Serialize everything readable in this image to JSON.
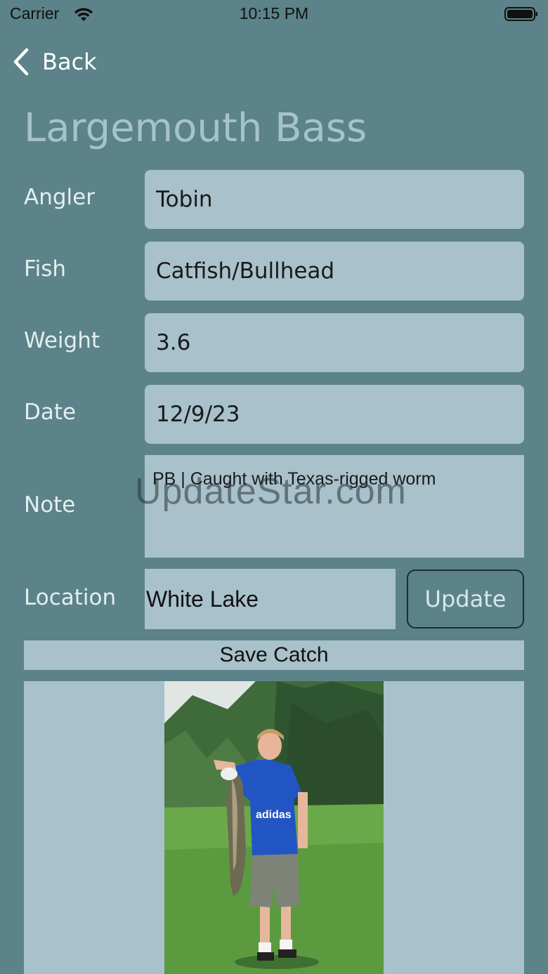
{
  "status_bar": {
    "carrier": "Carrier",
    "time": "10:15 PM",
    "wifi_icon": "wifi-icon",
    "battery_icon": "battery-full-icon"
  },
  "nav": {
    "back_label": "Back",
    "back_icon": "chevron-left-icon"
  },
  "title": "Largemouth Bass",
  "form": {
    "angler": {
      "label": "Angler",
      "value": "Tobin"
    },
    "fish": {
      "label": "Fish",
      "value": "Catfish/Bullhead"
    },
    "weight": {
      "label": "Weight",
      "value": "3.6"
    },
    "date": {
      "label": "Date",
      "value": "12/9/23"
    },
    "note": {
      "label": "Note",
      "value": "PB | Caught with Texas-rigged worm"
    },
    "location": {
      "label": "Location",
      "value": "White Lake",
      "update_label": "Update"
    }
  },
  "save_label": "Save Catch",
  "watermark": "UpdateStar.com",
  "colors": {
    "background": "#5b8389",
    "field": "#a8c1cb",
    "title": "#a6c2cb"
  }
}
